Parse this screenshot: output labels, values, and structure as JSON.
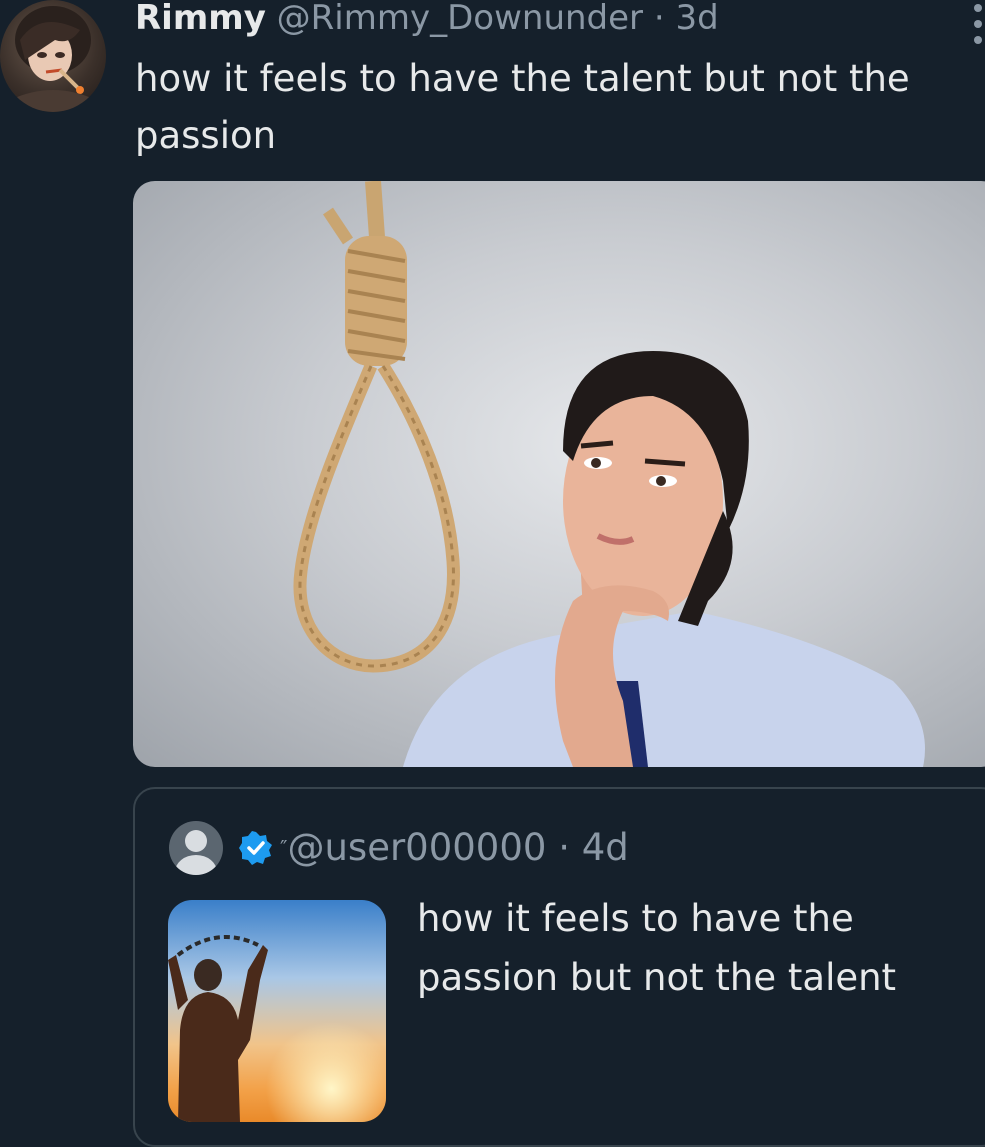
{
  "tweet": {
    "display_name": "Rimmy",
    "handle": "@Rimmy_Downunder",
    "separator": "·",
    "time": "3d",
    "text": "how it feels to have the talent but not the passion",
    "avatar_icon": "anime-avatar-icon",
    "more_icon": "more-options-icon"
  },
  "quoted_tweet": {
    "avatar_icon": "default-avatar-icon",
    "verified_icon": "verified-badge-icon",
    "tick": "″",
    "handle": "@user000000",
    "separator": "·",
    "time": "4d",
    "text": "how it feels to have the passion but not the talent"
  },
  "colors": {
    "background": "#15202b",
    "text_primary": "#e7e9ea",
    "text_secondary": "#8b98a5",
    "border": "#38444d",
    "verified": "#1d9bf0"
  }
}
